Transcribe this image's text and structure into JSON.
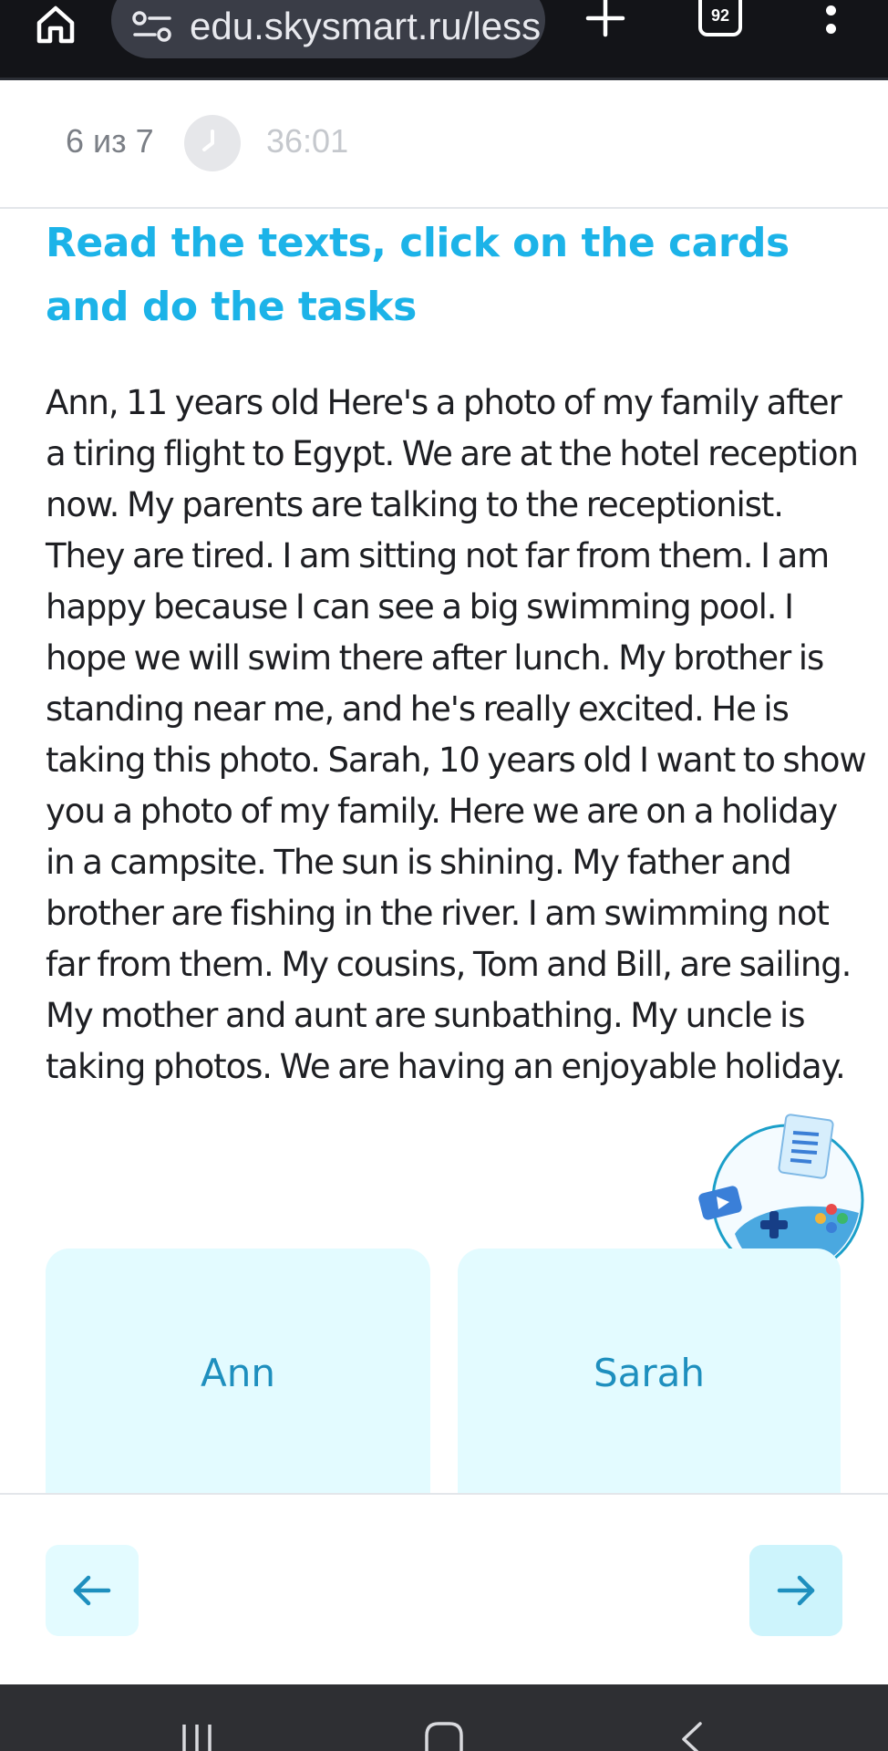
{
  "browser": {
    "url": "edu.skysmart.ru/less",
    "tab_count": "92",
    "icons": [
      "home-icon",
      "tune-icon",
      "plus-icon",
      "tab-switcher-icon",
      "more-vert-icon"
    ]
  },
  "progress": {
    "counter": "6 из 7",
    "timer": "36:01",
    "icons": [
      "clock-icon"
    ]
  },
  "task": {
    "title": "Read the texts, click on the cards and do the tasks",
    "text": "Ann, 11 years old Here's a photo of my family after a tiring flight to Egypt. We are at the hotel reception now. My parents are talking to the receptionist. They are tired. I am sitting not far from them. I am happy because I can see a big swimming pool. I hope we will swim there after lunch. My brother is standing near me, and he's really excited. He is taking this photo. Sarah, 10 years old I want to show you a photo of my family. Here we are on a holiday in a campsite. The sun is shining. My father and brother are fishing in the river. I am swimming not far from them. My cousins, Tom and Bill, are sailing. My mother and aunt are sunbathing. My uncle is taking photos. We are having an enjoyable holiday."
  },
  "cards": [
    {
      "label": "Ann"
    },
    {
      "label": "Sarah"
    }
  ],
  "navigation": {
    "prev_icon": "arrow-left-icon",
    "next_icon": "arrow-right-icon"
  },
  "colors": {
    "accent": "#1cb3e8",
    "card_bg": "#e3fbff",
    "card_text": "#1e8fbe",
    "browser_bar": "#131418",
    "system_bar": "#2e2f33"
  }
}
